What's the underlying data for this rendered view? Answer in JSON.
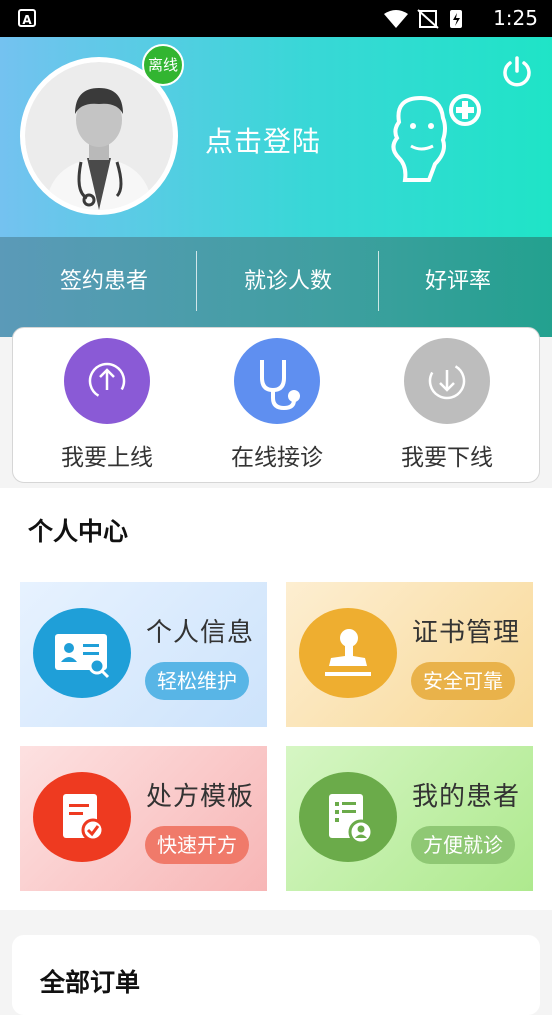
{
  "status_bar": {
    "notification": "A",
    "time": "1:25"
  },
  "header": {
    "badge": "离线",
    "login_text": "点击登陆"
  },
  "stats": {
    "items": [
      "签约患者",
      "就诊人数",
      "好评率"
    ]
  },
  "actions": {
    "items": [
      {
        "label": "我要上线",
        "color": "#8a5ad6"
      },
      {
        "label": "在线接诊",
        "color": "#5f8ff0"
      },
      {
        "label": "我要下线",
        "color": "#bdbdbd"
      }
    ]
  },
  "personal": {
    "title": "个人中心",
    "cards": [
      {
        "title": "个人信息",
        "tag": "轻松维护"
      },
      {
        "title": "证书管理",
        "tag": "安全可靠"
      },
      {
        "title": "处方模板",
        "tag": "快速开方"
      },
      {
        "title": "我的患者",
        "tag": "方便就诊"
      }
    ]
  },
  "orders": {
    "title": "全部订单"
  }
}
